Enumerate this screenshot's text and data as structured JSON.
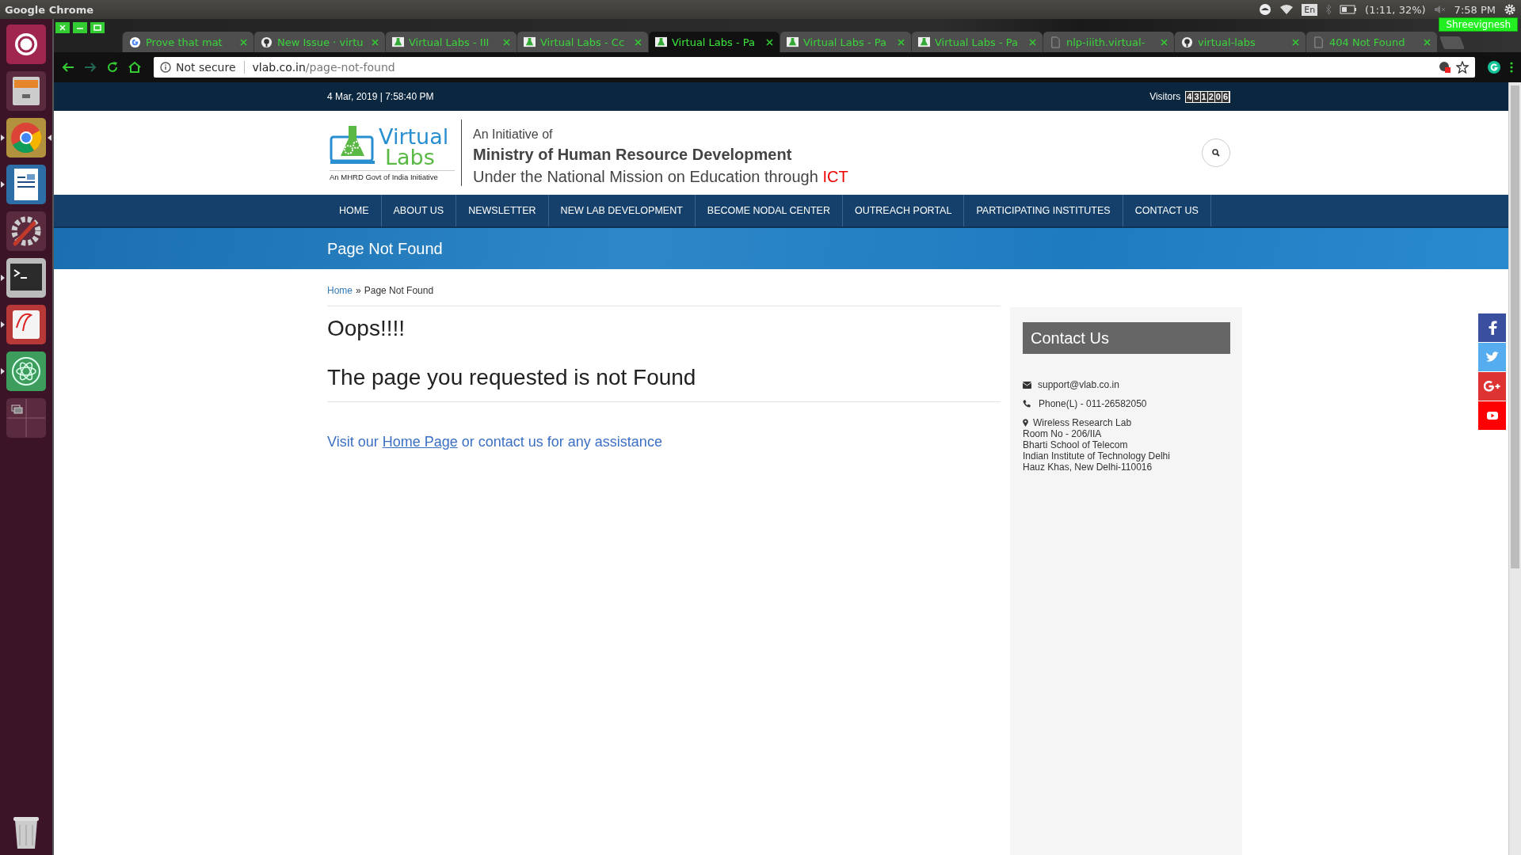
{
  "top_panel": {
    "app_title": "Google Chrome",
    "keyboard": "En",
    "battery": "(1:11, 32%)",
    "clock": "7:58 PM"
  },
  "launcher": [
    {
      "kind": "dash",
      "running": false,
      "focused": false
    },
    {
      "kind": "files",
      "running": false,
      "focused": false
    },
    {
      "kind": "chrome",
      "running": true,
      "focused": true
    },
    {
      "kind": "writer",
      "running": true,
      "focused": false
    },
    {
      "kind": "settings",
      "running": false,
      "focused": false
    },
    {
      "kind": "terminal",
      "running": true,
      "focused": false
    },
    {
      "kind": "reader",
      "running": true,
      "focused": false
    },
    {
      "kind": "atom",
      "running": true,
      "focused": false
    },
    {
      "kind": "workspaces",
      "running": false,
      "focused": false
    },
    {
      "kind": "trash",
      "running": false,
      "focused": false
    }
  ],
  "browser": {
    "profile": "Shreevignesh",
    "tabs": [
      {
        "title": "Prove that mat",
        "kind": "google",
        "selected": false
      },
      {
        "title": "New Issue · virtu",
        "kind": "github",
        "selected": false
      },
      {
        "title": "Virtual Labs - III",
        "kind": "flask",
        "selected": false
      },
      {
        "title": "Virtual Labs - Cc",
        "kind": "flask",
        "selected": false
      },
      {
        "title": "Virtual Labs - Pa",
        "kind": "flask",
        "selected": true
      },
      {
        "title": "Virtual Labs - Pa",
        "kind": "flask",
        "selected": false
      },
      {
        "title": "Virtual Labs - Pa",
        "kind": "flask",
        "selected": false
      },
      {
        "title": "nlp-iiith.virtual-",
        "kind": "page",
        "selected": false
      },
      {
        "title": "virtual-labs",
        "kind": "github",
        "selected": false
      },
      {
        "title": "404 Not Found",
        "kind": "page",
        "selected": false
      }
    ],
    "address": {
      "security": "Not secure",
      "host": "vlab.co.in",
      "path": "/page-not-found"
    }
  },
  "page": {
    "datetime": "4 Mar, 2019 | 7:58:40 PM",
    "visitors_label": "Visitors",
    "visitor_digits": [
      "4",
      "3",
      "1",
      "2",
      "0",
      "6"
    ],
    "logo": {
      "word1": "Virtual",
      "word2": "Labs",
      "tagline": "An MHRD Govt of India Initiative"
    },
    "initiative": "An Initiative of",
    "ministry": "Ministry of Human Resource Development",
    "mission": "Under the National Mission on Education through",
    "mission_highlight": "ICT",
    "nav": [
      "HOME",
      "ABOUT US",
      "NEWSLETTER",
      "NEW LAB DEVELOPMENT",
      "BECOME NODAL CENTER",
      "OUTREACH PORTAL",
      "PARTICIPATING INSTITUTES",
      "CONTACT US"
    ],
    "banner_title": "Page Not Found",
    "breadcrumb": {
      "home": "Home",
      "separator": "»",
      "current": "Page Not Found"
    },
    "heading": "Oops!!!!",
    "subheading": "The page you requested is not Found",
    "message": {
      "before": "Visit our",
      "link": "Home Page",
      "after": "or contact us for any assistance"
    },
    "contact": {
      "title": "Contact Us",
      "email": "support@vlab.co.in",
      "phone": "Phone(L) - 011-26582050",
      "address": [
        "Wireless Research Lab",
        "Room No - 206/IIA",
        "Bharti School of Telecom",
        "Indian Institute of Technology Delhi",
        "Hauz Khas, New Delhi-110016"
      ]
    },
    "social": [
      {
        "kind": "facebook"
      },
      {
        "kind": "twitter"
      },
      {
        "kind": "google-plus"
      },
      {
        "kind": "youtube"
      }
    ]
  }
}
